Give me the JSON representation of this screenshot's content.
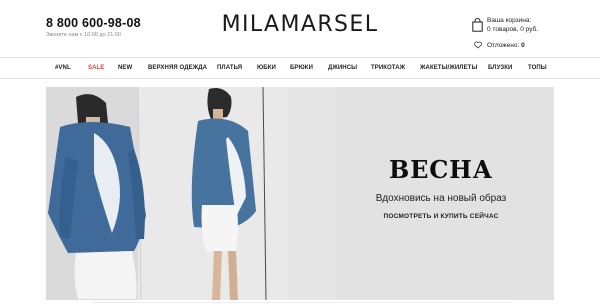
{
  "header": {
    "phone": "8 800 600-98-08",
    "hours": "Звоните нам с 10:00 до 21:00",
    "logo": "MILAMARSEL",
    "cart": {
      "title": "Ваша корзина:",
      "summary": "0 товаров, 0 руб."
    },
    "wishlist": {
      "label": "Отложено:",
      "count": "0"
    }
  },
  "nav": {
    "items": [
      {
        "label": "#VNL"
      },
      {
        "label": "SALE"
      },
      {
        "label": "NEW"
      },
      {
        "label": "ВЕРХНЯЯ ОДЕЖДА"
      },
      {
        "label": "ПЛАТЬЯ"
      },
      {
        "label": "ЮБКИ"
      },
      {
        "label": "БРЮКИ"
      },
      {
        "label": "ДЖИНСЫ"
      },
      {
        "label": "ТРИКОТАЖ"
      },
      {
        "label": "ЖАКЕТЫ/ЖИЛЕТЫ"
      },
      {
        "label": "БЛУЗКИ"
      },
      {
        "label": "ТОПЫ"
      }
    ],
    "sale_color": "#e53935"
  },
  "hero": {
    "title": "ВЕСНА",
    "subtitle": "Вдохновись на новый образ",
    "cta": "ПОСМОТРЕТЬ И КУПИТЬ СЕЙЧАС",
    "background": "#e2e2e2",
    "photo_description_icon": "model-photo"
  }
}
